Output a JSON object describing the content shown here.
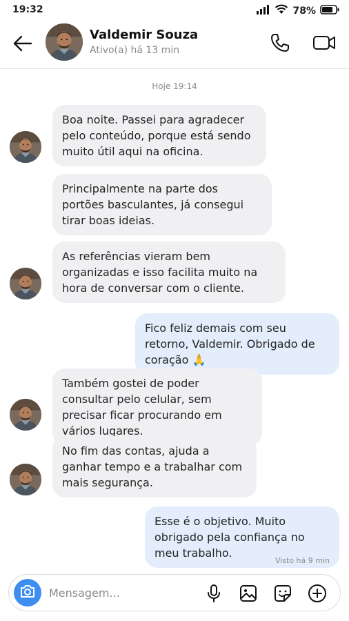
{
  "status_bar": {
    "time": "19:32",
    "battery": "78%"
  },
  "header": {
    "name": "Valdemir Souza",
    "presence": "Ativo(a) há 13 min"
  },
  "conversation": {
    "date_separator": "Hoje 19:14",
    "messages": [
      {
        "from": "contact",
        "text": "Boa noite. Passei para agradecer pelo conteúdo, porque está sendo muito útil aqui na oficina."
      },
      {
        "from": "contact",
        "text": "Principalmente na parte dos portões basculantes, já consegui tirar boas ideias."
      },
      {
        "from": "contact",
        "text": "As referências vieram bem organizadas e isso facilita muito na hora de conversar com o cliente."
      },
      {
        "from": "me",
        "text": "Fico feliz demais com seu retorno, Valdemir. Obrigado de coração 🙏"
      },
      {
        "from": "contact",
        "text": "Também gostei de poder consultar pelo celular, sem precisar ficar procurando em vários lugares."
      },
      {
        "from": "contact",
        "text": "No fim das contas, ajuda a ganhar tempo e a trabalhar com mais segurança."
      },
      {
        "from": "me",
        "text": "Esse é o objetivo. Muito obrigado pela confiança no meu trabalho."
      }
    ],
    "seen_status": "Visto há 9 min"
  },
  "composer": {
    "placeholder": "Mensagem..."
  },
  "icons": {
    "back": "arrow-left-icon",
    "call": "phone-icon",
    "video": "video-camera-icon",
    "camera": "camera-icon",
    "mic": "microphone-icon",
    "gallery": "image-icon",
    "sticker": "sticker-icon",
    "more": "plus-circle-icon"
  },
  "colors": {
    "incoming_bubble": "#f0f0f3",
    "outgoing_bubble": "#e3edfb",
    "accent": "#3d8ef0"
  }
}
